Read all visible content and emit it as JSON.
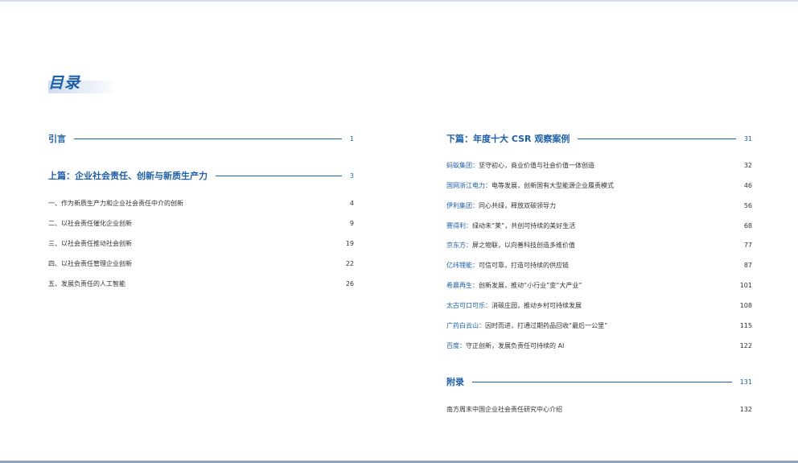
{
  "toc_title": "目录",
  "left_column": {
    "intro": {
      "title": "引言",
      "page": "1"
    },
    "part1": {
      "title": "上篇：企业社会责任、创新与新质生产力",
      "page": "3"
    },
    "entries": [
      {
        "text": "一、作为新质生产力和企业社会责任中介的创新",
        "page": "4"
      },
      {
        "text": "二、以社会责任催化企业创新",
        "page": "9"
      },
      {
        "text": "三、以社会责任推动社会创新",
        "page": "19"
      },
      {
        "text": "四、以社会责任管理企业创新",
        "page": "22"
      },
      {
        "text": "五、发展负责任的人工智能",
        "page": "26"
      }
    ]
  },
  "right_column": {
    "part2": {
      "title": "下篇：年度十大 CSR 观察案例",
      "page": "31"
    },
    "cases": [
      {
        "company": "蚂蚁集团：",
        "text": "坚守初心，商业价值与社会价值一体创造",
        "page": "32"
      },
      {
        "company": "国网浙江电力：",
        "text": "电等发展，创新国有大型能源企业履责模式",
        "page": "46"
      },
      {
        "company": "伊利集团：",
        "text": "同心共绿，释放双碳领导力",
        "page": "56"
      },
      {
        "company": "赛得利：",
        "text": "绿动未“莱”，共创可持续的美好生活",
        "page": "68"
      },
      {
        "company": "京东方：",
        "text": "屏之物联，以向善科技创造多维价值",
        "page": "77"
      },
      {
        "company": "亿纬锂能：",
        "text": "可信可靠，打造可持续的供应链",
        "page": "87"
      },
      {
        "company": "希晨再生：",
        "text": "创新发展，推动“小行业”变“大产业”",
        "page": "101"
      },
      {
        "company": "太古可口可乐：",
        "text": "消碳庄园，推动乡村可持续发展",
        "page": "108"
      },
      {
        "company": "广药白云山：",
        "text": "因时而进，打通过期药品回收“最后一公里”",
        "page": "115"
      },
      {
        "company": "百度：",
        "text": "守正创新，发展负责任可持续的 AI",
        "page": "122"
      }
    ],
    "appendix": {
      "title": "附录",
      "page": "131"
    },
    "appendix_entries": [
      {
        "text": "南方周末中国企业社会责任研究中心介绍",
        "page": "132"
      }
    ]
  }
}
